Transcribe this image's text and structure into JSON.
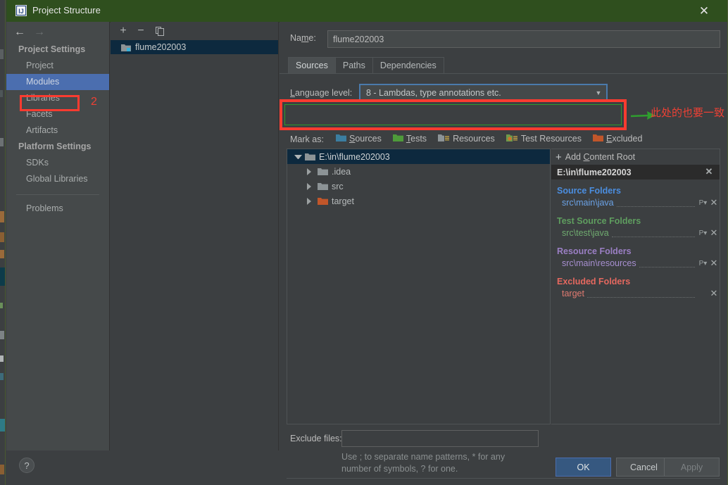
{
  "window": {
    "title": "Project Structure",
    "app_icon": "intellij-idea-icon",
    "close_label": "✕"
  },
  "nav": {
    "back_icon": "←",
    "forward_icon": "→",
    "groups": [
      {
        "label": "Project Settings",
        "items": [
          {
            "label": "Project",
            "selected": false
          },
          {
            "label": "Modules",
            "selected": true
          },
          {
            "label": "Libraries",
            "selected": false
          },
          {
            "label": "Facets",
            "selected": false
          },
          {
            "label": "Artifacts",
            "selected": false
          }
        ]
      },
      {
        "label": "Platform Settings",
        "items": [
          {
            "label": "SDKs",
            "selected": false
          },
          {
            "label": "Global Libraries",
            "selected": false
          }
        ]
      }
    ],
    "problems_label": "Problems"
  },
  "modules_panel": {
    "toolbar": {
      "add_label": "+",
      "remove_label": "−",
      "copy_label": "copy-icon"
    },
    "items": [
      {
        "label": "flume202003",
        "selected": true
      }
    ]
  },
  "editor": {
    "name_label": "Name:",
    "name_value": "flume202003",
    "tabs": [
      {
        "label": "Sources",
        "active": true
      },
      {
        "label": "Paths",
        "active": false
      },
      {
        "label": "Dependencies",
        "active": false
      }
    ],
    "language_level": {
      "label": "Language level:",
      "value": "8 - Lambdas, type annotations etc.",
      "arrow": "▼"
    },
    "mark_as": {
      "label": "Mark as:",
      "items": [
        {
          "label": "Sources",
          "color": "#3b7ea1",
          "kind": "folder"
        },
        {
          "label": "Tests",
          "color": "#4e9a3a",
          "kind": "folder"
        },
        {
          "label": "Resources",
          "color": "#8c9396",
          "kind": "folder-lines"
        },
        {
          "label": "Test Resources",
          "color": "#6f9a4a",
          "kind": "folder-lines"
        },
        {
          "label": "Excluded",
          "color": "#c1562a",
          "kind": "folder"
        }
      ]
    },
    "tree": [
      {
        "label": "E:\\in\\flume202003",
        "depth": 0,
        "expanded": true,
        "selected": true,
        "folder_color": "#8c9396"
      },
      {
        "label": ".idea",
        "depth": 1,
        "expanded": false,
        "selected": false,
        "folder_color": "#8c9396"
      },
      {
        "label": "src",
        "depth": 1,
        "expanded": false,
        "selected": false,
        "folder_color": "#8c9396"
      },
      {
        "label": "target",
        "depth": 1,
        "expanded": false,
        "selected": false,
        "folder_color": "#c1562a"
      }
    ],
    "content_roots": {
      "add_label": "Add Content Root",
      "add_icon": "+",
      "root_path": "E:\\in\\flume202003",
      "remove_icon": "✕",
      "sections": [
        {
          "title": "Source Folders",
          "color": "#4b8ee0",
          "rows": [
            {
              "path": "src\\main\\java",
              "color": "#6ba2e6",
              "has_package_prefix": true
            }
          ]
        },
        {
          "title": "Test Source Folders",
          "color": "#5f9e5f",
          "rows": [
            {
              "path": "src\\test\\java",
              "color": "#6faa6f",
              "has_package_prefix": true
            }
          ]
        },
        {
          "title": "Resource Folders",
          "color": "#9b7fc4",
          "rows": [
            {
              "path": "src\\main\\resources",
              "color": "#a78fd0",
              "has_package_prefix": true
            }
          ]
        },
        {
          "title": "Excluded Folders",
          "color": "#e5685f",
          "rows": [
            {
              "path": "target",
              "color": "#e07a70",
              "has_package_prefix": false
            }
          ]
        }
      ]
    },
    "exclude_files": {
      "label": "Exclude files:",
      "value": "",
      "hint_line1": "Use ; to separate name patterns, * for any",
      "hint_line2": "number of symbols, ? for one."
    }
  },
  "footer": {
    "help_label": "?",
    "ok_label": "OK",
    "cancel_label": "Cancel",
    "apply_label": "Apply"
  },
  "annotations": {
    "modules_marker": "2",
    "language_note": "此处的也要一致",
    "box_color": "#fb3b30",
    "inner_box_color": "#2d9a2d",
    "arrow_color": "#2f9e2f",
    "text_color": "#ef4034"
  }
}
